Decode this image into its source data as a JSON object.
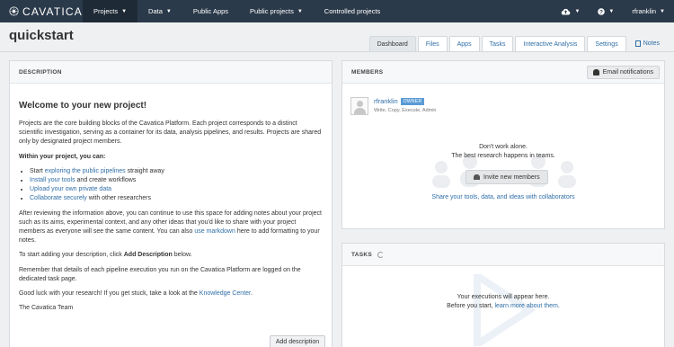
{
  "brand": {
    "name": "CAVATICA"
  },
  "nav": {
    "items": [
      {
        "label": "Projects",
        "caret": true,
        "active": true
      },
      {
        "label": "Data",
        "caret": true
      },
      {
        "label": "Public Apps",
        "caret": false
      },
      {
        "label": "Public projects",
        "caret": true
      },
      {
        "label": "Controlled projects",
        "caret": false
      }
    ],
    "user": "rfranklin"
  },
  "project": {
    "title": "quickstart"
  },
  "tabs": [
    {
      "label": "Dashboard",
      "active": true
    },
    {
      "label": "Files"
    },
    {
      "label": "Apps"
    },
    {
      "label": "Tasks"
    },
    {
      "label": "Interactive Analysis"
    },
    {
      "label": "Settings"
    },
    {
      "label": "Notes"
    }
  ],
  "description": {
    "header": "DESCRIPTION",
    "welcome": "Welcome to your new project!",
    "intro": "Projects are the core building blocks of the Cavatica Platform. Each project corresponds to a distinct scientific investigation, serving as a container for its data, analysis pipelines, and results. Projects are shared only by designated project members.",
    "within_label": "Within your project, you can:",
    "bullets": [
      {
        "pre": "Start ",
        "link": "exploring the public pipelines",
        "post": " straight away"
      },
      {
        "pre": "",
        "link": "Install your tools",
        "post": " and create workflows"
      },
      {
        "pre": "",
        "link": "Upload your own private data",
        "post": ""
      },
      {
        "pre": "",
        "link": "Collaborate securely",
        "post": " with other researchers"
      }
    ],
    "after_pre": "After reviewing the information above, you can continue to use this space for adding notes about your project such as its aims, experimental context, and any other ideas that you'd like to share with your project members as everyone will see the same content. You can also ",
    "after_link": "use markdown",
    "after_post": " here to add formatting to your notes.",
    "start_pre": "To start adding your description, click ",
    "start_bold": "Add Description",
    "start_post": " below.",
    "remember": "Remember that details of each pipeline execution you run on the Cavatica Platform are logged on the dedicated task page.",
    "luck_pre": "Good luck with your research! If you get stuck, take a look at the ",
    "luck_link": "Knowledge Center",
    "luck_post": ".",
    "signoff": "The Cavatica Team",
    "add_button": "Add description"
  },
  "members": {
    "header": "MEMBERS",
    "email_button": "Email notifications",
    "member_name": "rfranklin",
    "member_badge": "OWNER",
    "member_permissions": "Write, Copy, Execute, Admin",
    "msg_line1": "Don't work alone.",
    "msg_line2": "The best research happens in teams.",
    "invite_button": "Invite new members",
    "share_link": "Share your tools, data, and ideas with collaborators"
  },
  "tasks": {
    "header": "TASKS",
    "msg_line1": "Your executions will appear here.",
    "msg_pre": "Before you start, ",
    "msg_link": "learn more about them",
    "msg_post": "."
  }
}
